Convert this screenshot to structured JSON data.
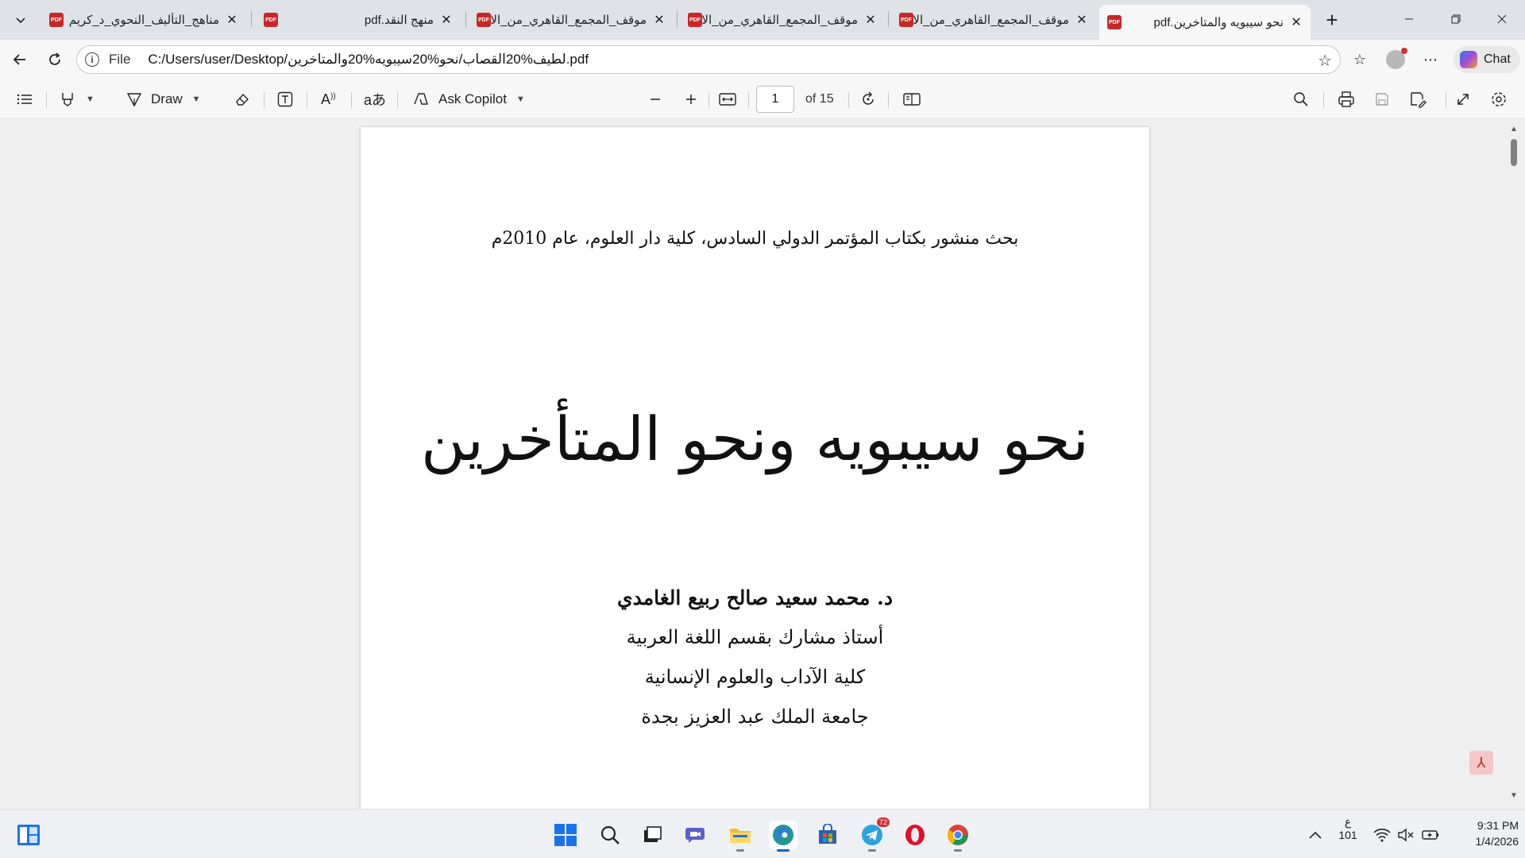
{
  "browser": {
    "tabs": [
      {
        "title": "مناهج_التأليف_النحوي_د_كريم",
        "favicon": "pdf-icon",
        "active": false
      },
      {
        "title": "منهج النقد.pdf",
        "favicon": "pdf-icon",
        "active": false
      },
      {
        "title": "موقف_المجمع_القاهري_من_الا",
        "favicon": "pdf-icon",
        "active": false
      },
      {
        "title": "موقف_المجمع_القاهري_من_الا",
        "favicon": "pdf-icon",
        "active": false
      },
      {
        "title": "موقف_المجمع_القاهري_من_الا",
        "favicon": "pdf-icon",
        "active": false
      },
      {
        "title": "نحو سيبويه والمتاخرين.pdf",
        "favicon": "pdf-icon",
        "active": true
      }
    ],
    "address": {
      "scheme": "File",
      "url": "C:/Users/user/Desktop/لطيف%20القصاب/نحو%20سيبويه%20والمتاخرين.pdf"
    },
    "chat_label": "Chat"
  },
  "pdf_toolbar": {
    "draw_label": "Draw",
    "ask_copilot_label": "Ask Copilot",
    "page_number": "1",
    "page_count": "of 15"
  },
  "document": {
    "publication_note": "بحث منشور بكتاب المؤتمر الدولي السادس، كلية دار العلوم، عام 2010م",
    "title": "نحو سيبويه ونحو المتأخرين",
    "author": "د. محمد سعيد صالح ربيع الغامدي",
    "affiliation": [
      "أستاذ مشارك بقسم اللغة العربية",
      "كلية الآداب والعلوم الإنسانية",
      "جامعة الملك عبد العزيز بجدة"
    ]
  },
  "taskbar": {
    "telegram_badge": "72",
    "keyboard_lang": "ع",
    "keyboard_code": "101",
    "time": "9:31 PM",
    "date": "1/4/2026"
  },
  "colors": {
    "pdf_red": "#c62828",
    "accent_blue": "#0067c0"
  }
}
